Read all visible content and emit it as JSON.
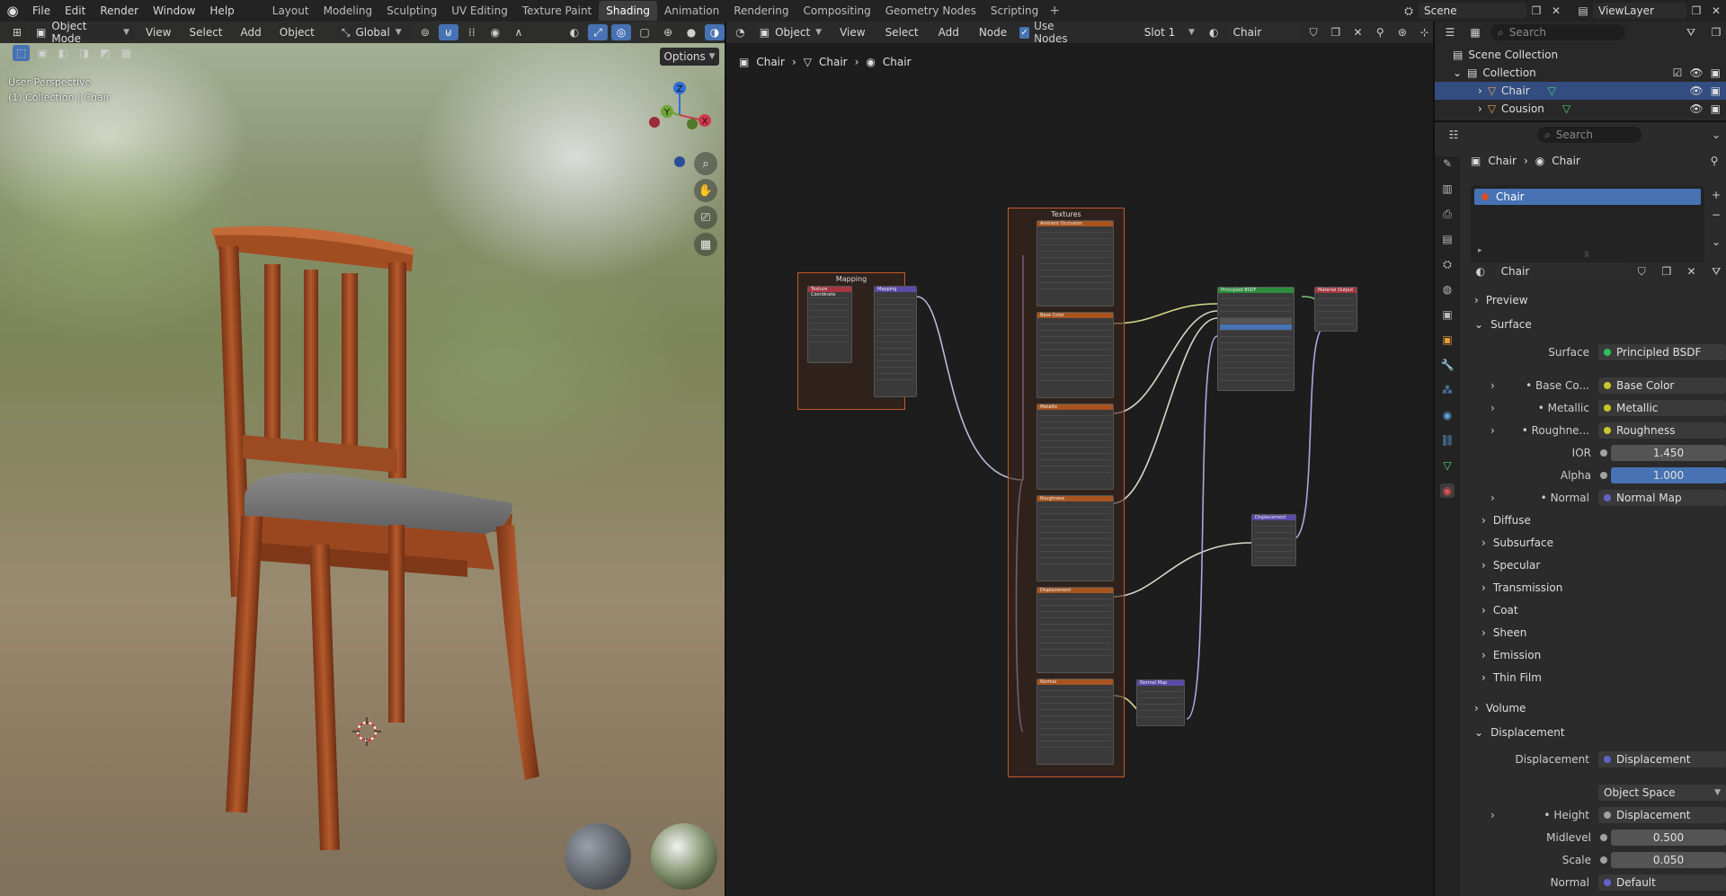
{
  "menu": [
    "File",
    "Edit",
    "Render",
    "Window",
    "Help"
  ],
  "workspaces": [
    "Layout",
    "Modeling",
    "Sculpting",
    "UV Editing",
    "Texture Paint",
    "Shading",
    "Animation",
    "Rendering",
    "Compositing",
    "Geometry Nodes",
    "Scripting"
  ],
  "active_workspace": "Shading",
  "scene": "Scene",
  "view_layer": "ViewLayer",
  "viewport": {
    "mode": "Object Mode",
    "menus": [
      "View",
      "Select",
      "Add",
      "Object"
    ],
    "transform": "Global",
    "options": "Options",
    "overlay_line1": "User Perspective",
    "overlay_line2": "(1) Collection | Chair",
    "axes": {
      "x": "X",
      "y": "Y",
      "z": "Z"
    }
  },
  "node_editor": {
    "mode": "Object",
    "menus": [
      "View",
      "Select",
      "Add",
      "Node"
    ],
    "use_nodes": "Use Nodes",
    "slot": "Slot 1",
    "material": "Chair",
    "breadcrumb": [
      "Chair",
      "Chair",
      "Chair"
    ],
    "frames": {
      "mapping": "Mapping",
      "textures": "Textures"
    },
    "nodes": {
      "texcoord": "Texture Coordinate",
      "mapping": "Mapping",
      "tex_ao": "Ambient Occlusion",
      "tex_base": "Base Color",
      "tex_metal": "Metallic",
      "tex_rough": "Roughness",
      "tex_disp": "Displacement",
      "tex_normal": "Normal",
      "bsdf": "Principled BSDF",
      "output": "Material Output",
      "displacement": "Displacement",
      "normalmap": "Normal Map"
    }
  },
  "outliner": {
    "search_placeholder": "Search",
    "scene_collection": "Scene Collection",
    "collection": "Collection",
    "objects": [
      "Chair",
      "Cousion"
    ]
  },
  "properties": {
    "search_placeholder": "Search",
    "breadcrumb": [
      "Chair",
      "Chair"
    ],
    "slot_item": "Chair",
    "material_name": "Chair",
    "sections": {
      "preview": "Preview",
      "surface": "Surface",
      "volume": "Volume",
      "displacement": "Displacement"
    },
    "surface": {
      "surface_label": "Surface",
      "surface_value": "Principled BSDF",
      "base_label": "Base Co...",
      "base_value": "Base Color",
      "metallic_label": "Metallic",
      "metallic_value": "Metallic",
      "rough_label": "Roughne...",
      "rough_value": "Roughness",
      "ior_label": "IOR",
      "ior_value": "1.450",
      "alpha_label": "Alpha",
      "alpha_value": "1.000",
      "normal_label": "Normal",
      "normal_value": "Normal Map"
    },
    "subsections": [
      "Diffuse",
      "Subsurface",
      "Specular",
      "Transmission",
      "Coat",
      "Sheen",
      "Emission",
      "Thin Film"
    ],
    "disp": {
      "disp_label": "Displacement",
      "disp_value": "Displacement",
      "space_value": "Object Space",
      "height_label": "Height",
      "height_value": "Displacement",
      "mid_label": "Midlevel",
      "mid_value": "0.500",
      "scale_label": "Scale",
      "scale_value": "0.050",
      "normal_label": "Normal",
      "normal_value": "Default"
    }
  },
  "colors": {
    "accent": "#4772b3",
    "frame": "#c25a2a",
    "bsdf_header": "#2c8c3c",
    "socket_yellow": "#c7c729",
    "socket_gray": "#a1a1a1",
    "socket_purple": "#6363c7"
  }
}
